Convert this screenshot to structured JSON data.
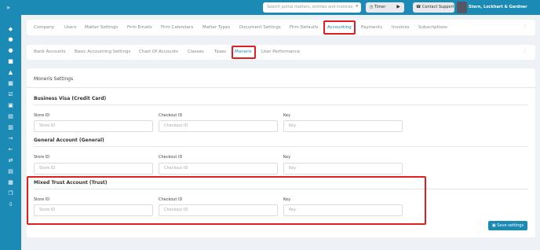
{
  "sidebar": {
    "collapse_glyph": "»",
    "icons": [
      "layers-icon",
      "users-icon",
      "person-icon",
      "calendar-icon",
      "home-icon",
      "calendar-grid-icon",
      "check-square-icon",
      "inbox-icon",
      "document-icon",
      "bank-icon",
      "arrow-right-icon",
      "arrow-left-icon",
      "transfer-icon",
      "file-icon",
      "notes-icon",
      "copy-icon",
      "logout-icon"
    ]
  },
  "topbar": {
    "search_placeholder": "Search portal matters, entities and invoices",
    "timer_label": "Timer",
    "support_label": "Contact Support",
    "firm_name": "Stern, Lockhart & Gardner"
  },
  "nav_primary": [
    "Company",
    "Users",
    "Matter Settings",
    "Firm Emails",
    "Firm Calendars",
    "Matter Types",
    "Document Settings",
    "Firm Defaults",
    "Accounting",
    "Payments",
    "Invoices",
    "Subscriptions"
  ],
  "nav_primary_active": "Accounting",
  "nav_secondary": [
    "Bank Accounts",
    "Basic Accounting Settings",
    "Chart Of Accounts",
    "Classes",
    "Taxes",
    "Moneris",
    "User Performance"
  ],
  "nav_secondary_active": "Moneris",
  "page": {
    "title": "Moneris Settings",
    "sections": [
      {
        "title": "Business Visa (Credit Card)",
        "fields": [
          {
            "label": "Store ID",
            "placeholder": "Store ID"
          },
          {
            "label": "Checkout ID",
            "placeholder": "Checkout ID"
          },
          {
            "label": "Key",
            "placeholder": "Key"
          }
        ]
      },
      {
        "title": "General Account (General)",
        "fields": [
          {
            "label": "Store ID",
            "placeholder": "Store ID"
          },
          {
            "label": "Checkout ID",
            "placeholder": "Checkout ID"
          },
          {
            "label": "Key",
            "placeholder": "Key"
          }
        ]
      },
      {
        "title": "Mixed Trust Account (Trust)",
        "fields": [
          {
            "label": "Store ID",
            "placeholder": "Store ID"
          },
          {
            "label": "Checkout ID",
            "placeholder": "Checkout ID"
          },
          {
            "label": "Key",
            "placeholder": "Key"
          }
        ]
      }
    ],
    "save_label": "Save settings"
  },
  "colors": {
    "brand": "#1b8ab4",
    "highlight": "#e02020",
    "background": "#eef2f6"
  }
}
